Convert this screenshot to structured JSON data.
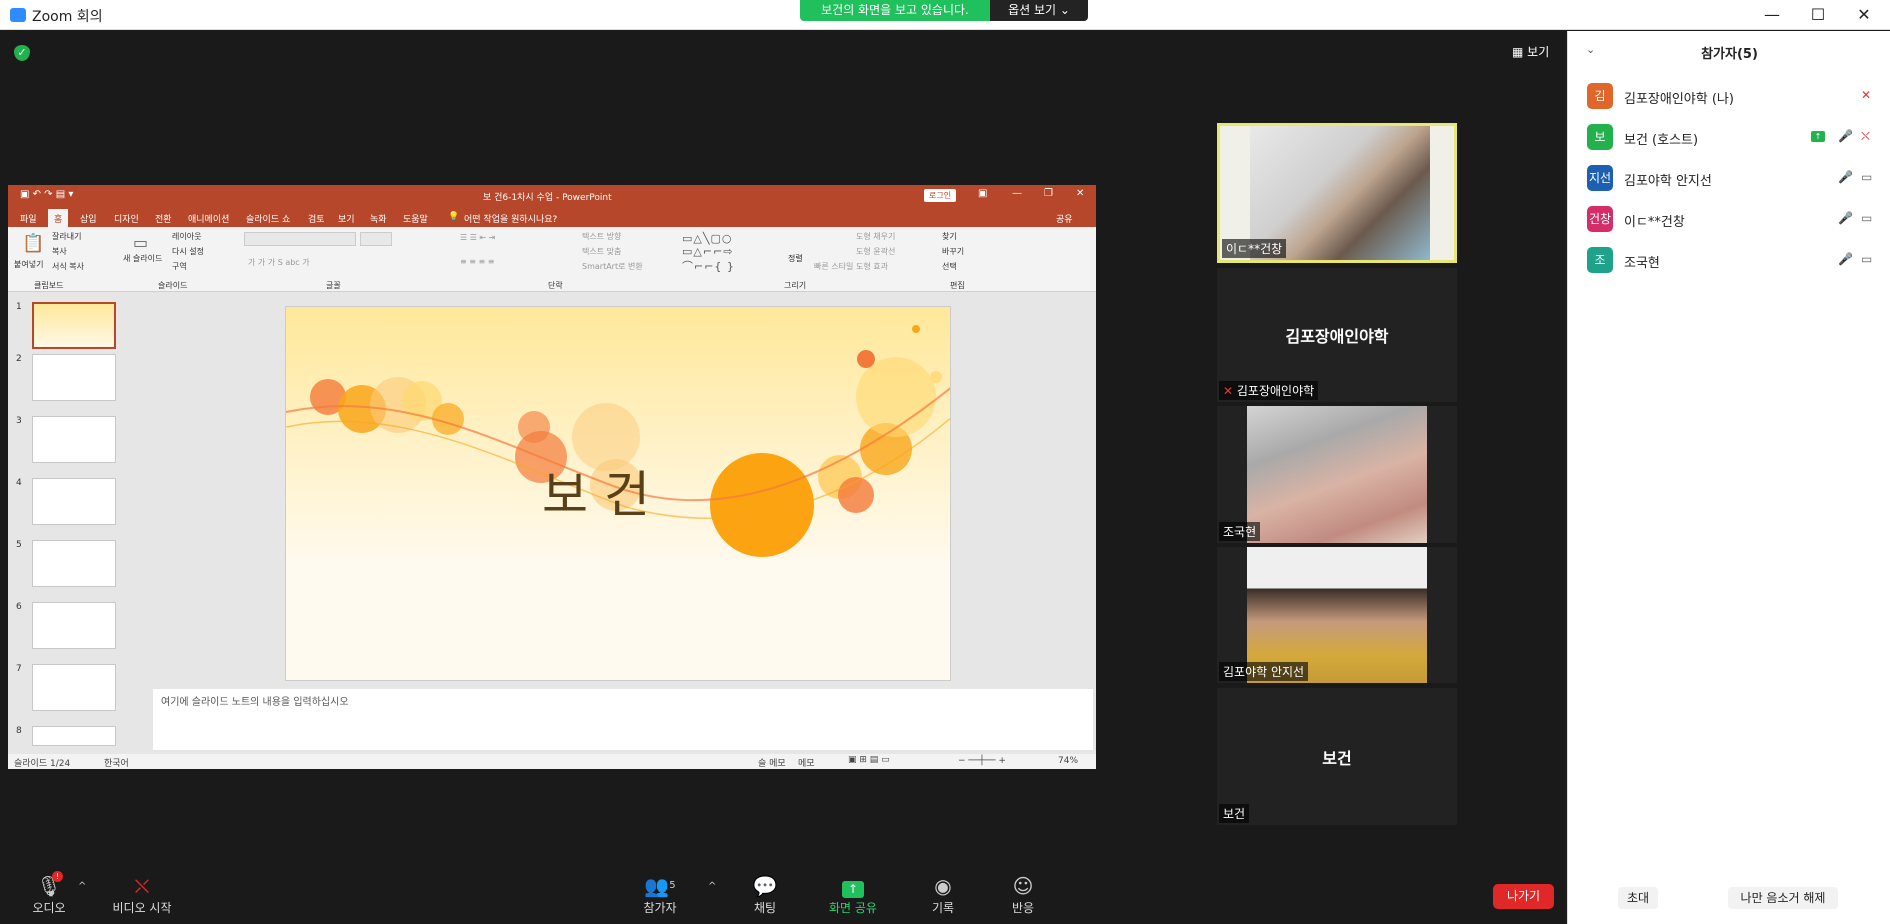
{
  "window": {
    "title": "Zoom 회의",
    "minimize": "—",
    "maximize": "☐",
    "close": "✕"
  },
  "banner": {
    "sharing_text": "보건의 화면을 보고 있습니다.",
    "view_options": "옵션 보기 ⌄"
  },
  "view_button": "보기",
  "powerpoint": {
    "title": "보  건6-1차시 수업  -  PowerPoint",
    "login": "로그인",
    "tabs": [
      "파일",
      "홈",
      "삽입",
      "디자인",
      "전환",
      "애니메이션",
      "슬라이드 쇼",
      "검토",
      "보기",
      "녹화",
      "도움말"
    ],
    "tell_me": "어떤 작업을 원하시나요?",
    "share": "공유",
    "groups": [
      "클립보드",
      "슬라이드",
      "글꼴",
      "단락",
      "그리기",
      "편집"
    ],
    "ribbon_items": {
      "paste": "붙여넣기",
      "cut": "잘라내기",
      "copy": "복사",
      "format_painter": "서식 복사",
      "new_slide": "새 슬라이드",
      "layout": "레이아웃",
      "reset": "다시 설정",
      "section": "구역",
      "text_direction": "텍스트 방향",
      "align_text": "텍스트 맞춤",
      "smartart": "SmartArt로 변환",
      "arrange": "정렬",
      "quick_styles": "빠른 스타일",
      "shape_fill": "도형 채우기",
      "shape_outline": "도형 윤곽선",
      "shape_effects": "도형 효과",
      "find": "찾기",
      "replace": "바꾸기",
      "select": "선택"
    },
    "thumb_numbers": [
      "1",
      "2",
      "3",
      "4",
      "5",
      "6",
      "7",
      "8"
    ],
    "slide_title": "보   건",
    "notes_placeholder": "여기에 슬라이드 노트의 내용을 입력하십시오",
    "status_slide": "슬라이드 1/24",
    "status_lang": "한국어",
    "status_notes": "슬 메모",
    "status_comments": "메모",
    "status_zoom": "74%"
  },
  "tiles": [
    {
      "name": "이ㄷ**건창",
      "type": "video"
    },
    {
      "name": "김포장애인야학",
      "center": "김포장애인야학",
      "type": "avatar"
    },
    {
      "name": "조국현",
      "type": "video"
    },
    {
      "name": "김포야학 안지선",
      "type": "video"
    },
    {
      "name": "보건",
      "center": "보건",
      "type": "avatar"
    }
  ],
  "toolbar": {
    "audio": "오디오",
    "video": "비디오 시작",
    "participants": "참가자",
    "participants_count": "5",
    "chat": "채팅",
    "share": "화면 공유",
    "record": "기록",
    "reactions": "반응",
    "leave": "나가기",
    "audio_badge": "!"
  },
  "panel": {
    "title": "참가자(5)",
    "invite": "초대",
    "unmute_me": "나만 음소거 해제",
    "participants": [
      {
        "initial": "김",
        "name": "김포장애인야학 (나)",
        "color": "#e0662a"
      },
      {
        "initial": "보",
        "name": "보건 (호스트)",
        "color": "#23b14d"
      },
      {
        "initial": "지선",
        "name": "김포야학 안지선",
        "color": "#1d5fb0"
      },
      {
        "initial": "건창",
        "name": "이ㄷ**건창",
        "color": "#d42d6a"
      },
      {
        "initial": "조",
        "name": "조국현",
        "color": "#1ea38a"
      }
    ]
  }
}
